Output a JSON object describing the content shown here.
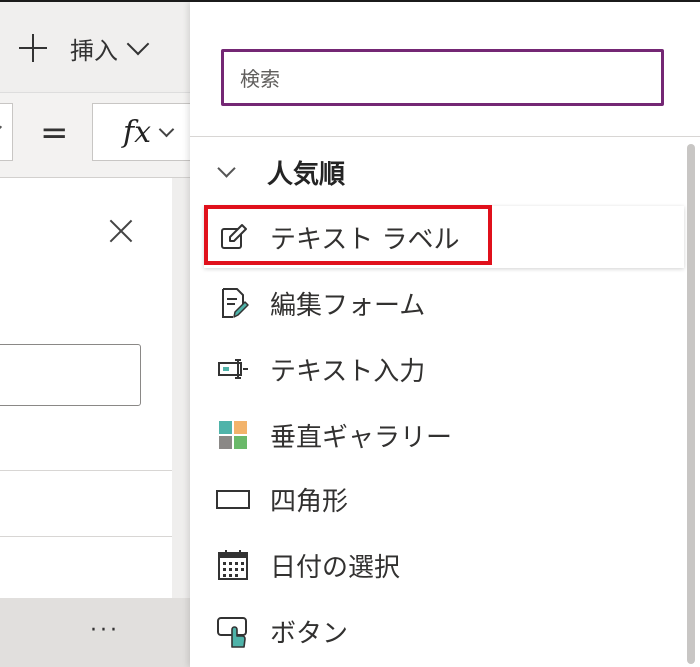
{
  "toolbar": {
    "insert_label": "挿入"
  },
  "formula": {
    "equals": "=",
    "fx": "fx"
  },
  "bottom": {
    "more": "···"
  },
  "flyout": {
    "search_placeholder": "検索",
    "group_label": "人気順",
    "items": [
      {
        "label": "テキスト ラベル",
        "icon": "edit-label-icon",
        "selected": true
      },
      {
        "label": "編集フォーム",
        "icon": "edit-form-icon"
      },
      {
        "label": "テキスト入力",
        "icon": "text-input-icon"
      },
      {
        "label": "垂直ギャラリー",
        "icon": "gallery-icon"
      },
      {
        "label": "四角形",
        "icon": "rectangle-icon"
      },
      {
        "label": "日付の選択",
        "icon": "calendar-icon"
      },
      {
        "label": "ボタン",
        "icon": "button-icon"
      }
    ]
  },
  "colors": {
    "search_border": "#742774",
    "highlight": "#e0101b",
    "gallery_teal": "#4fb3a9",
    "gallery_orange": "#f2b36b",
    "gallery_green": "#6ab96a",
    "gallery_gray": "#8a8886"
  }
}
